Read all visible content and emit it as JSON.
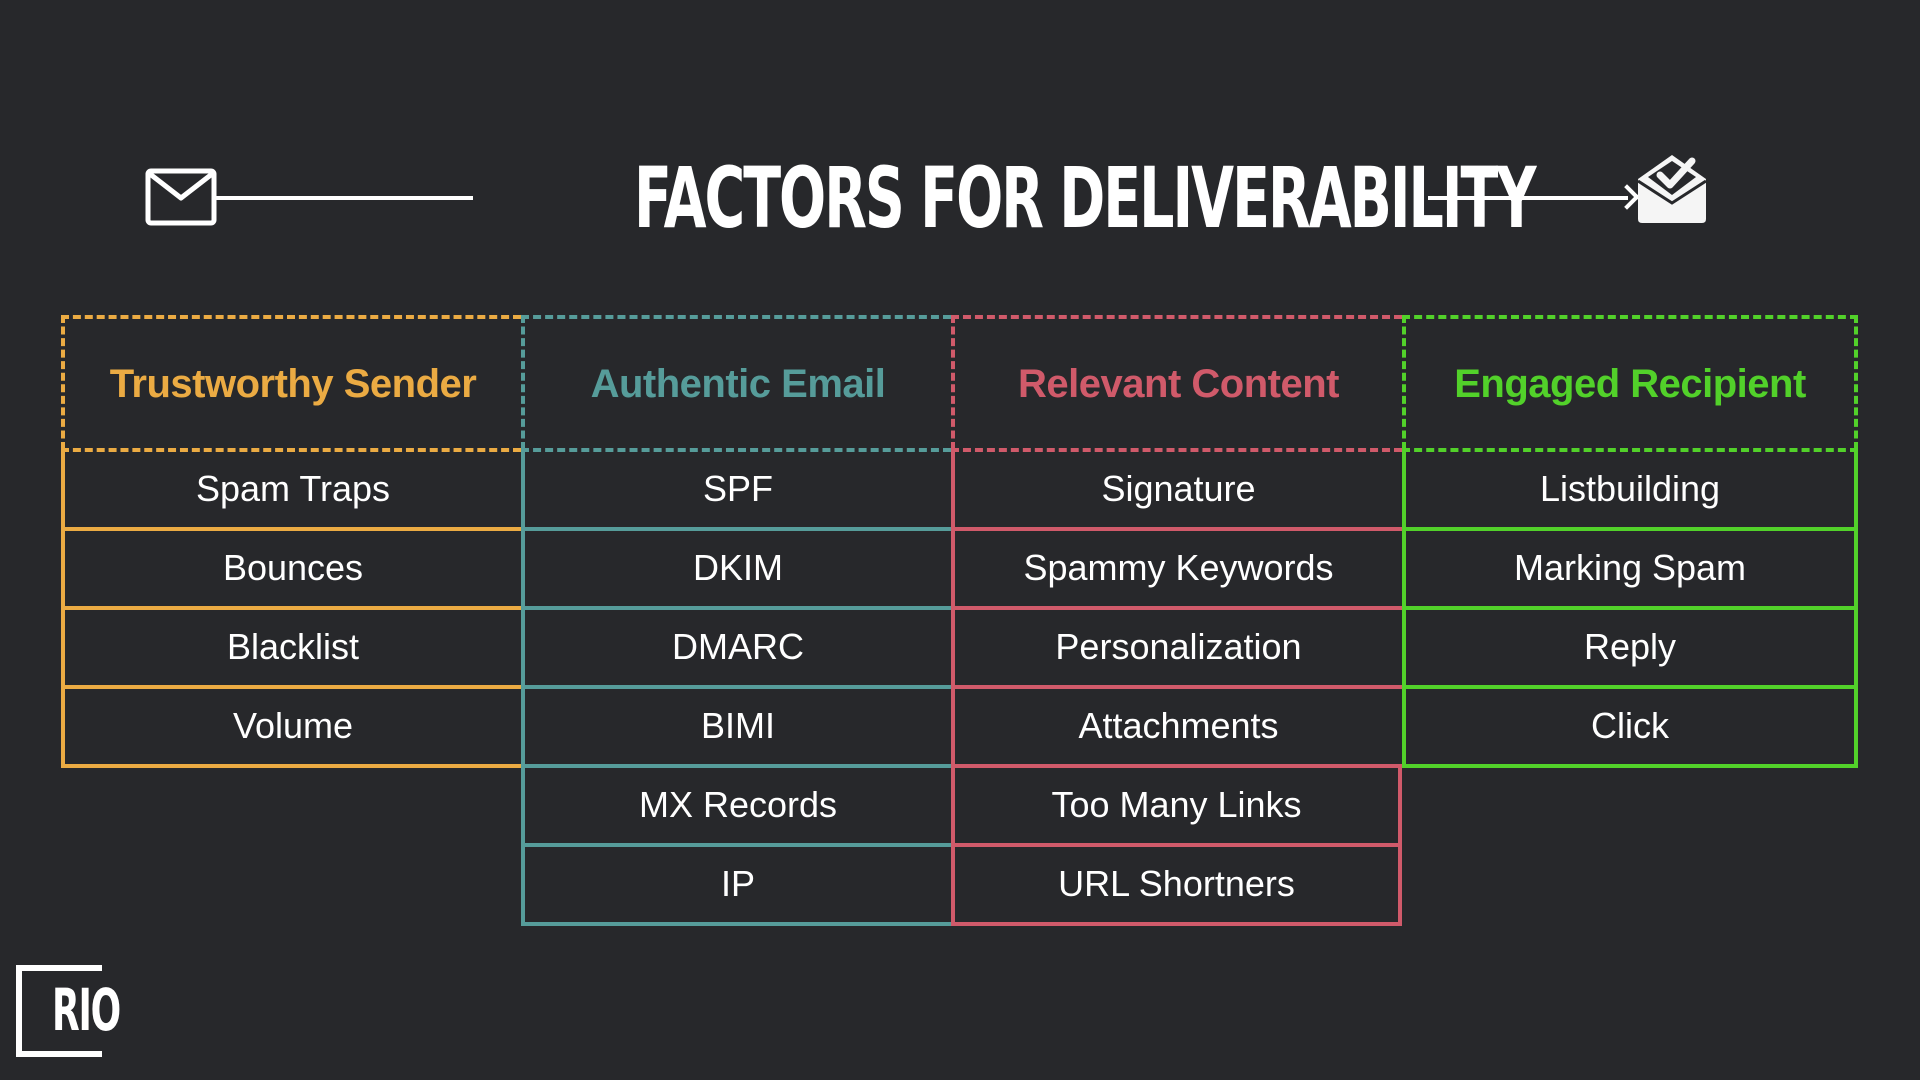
{
  "title": "FACTORS FOR DELIVERABILITY",
  "icons": {
    "left": "envelope-icon",
    "right": "open-envelope-check-icon"
  },
  "logo": "RIO",
  "colors": {
    "background": "#27282b",
    "trustworthy": "#ebab43",
    "authentic": "#569c9a",
    "relevant": "#d05a6a",
    "engaged": "#52d12a"
  },
  "columns": [
    {
      "header": "Trustworthy Sender",
      "items": [
        "Spam Traps",
        "Bounces",
        "Blacklist",
        "Volume"
      ]
    },
    {
      "header": "Authentic Email",
      "items": [
        "SPF",
        "DKIM",
        "DMARC",
        "BIMI",
        "MX Records",
        "IP"
      ]
    },
    {
      "header": "Relevant Content",
      "items": [
        "Signature",
        "Spammy Keywords",
        "Personalization",
        "Attachments",
        "Too Many Links",
        "URL Shortners"
      ]
    },
    {
      "header": "Engaged Recipient",
      "items": [
        "Listbuilding",
        "Marking Spam",
        "Reply",
        "Click"
      ]
    }
  ]
}
